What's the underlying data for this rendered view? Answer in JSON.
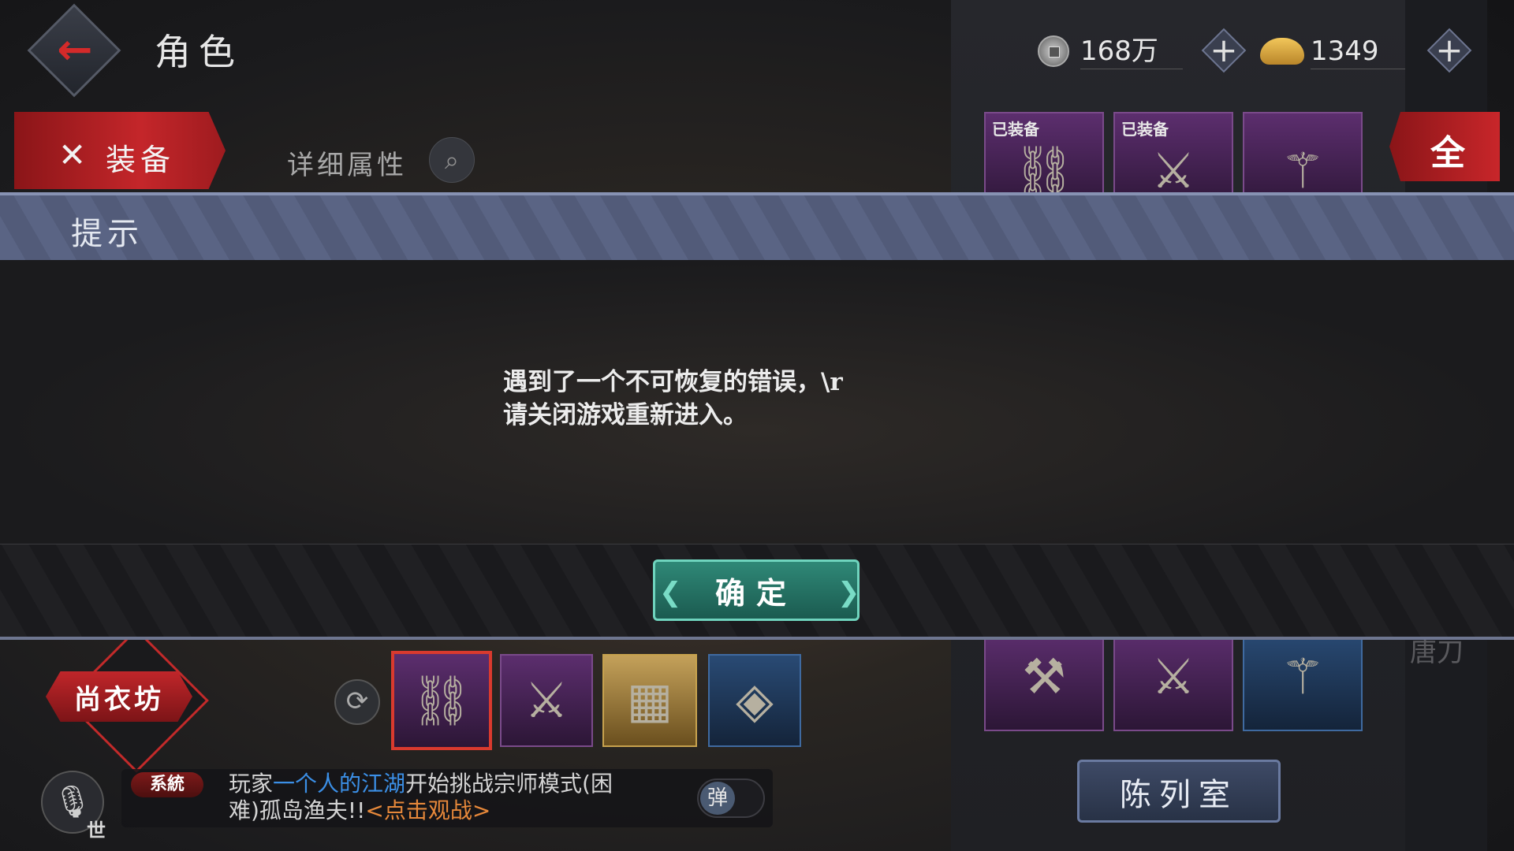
{
  "header": {
    "title": "角色",
    "back_icon": "back-arrow-icon"
  },
  "currency": {
    "coins": "168万",
    "ingots": "1349",
    "plus_label": "+"
  },
  "tabs": {
    "equip_label": "装备",
    "equip_icon": "✕",
    "detail_label": "详细属性",
    "search_icon": "⌕"
  },
  "inventory": {
    "equipped_tag": "已装备",
    "filter_label": "全",
    "top_slots": [
      {
        "equipped": true,
        "glyph": "⛓"
      },
      {
        "equipped": true,
        "glyph": "⚔"
      },
      {
        "equipped": false,
        "glyph": "⚚"
      }
    ],
    "bottom_slots": [
      {
        "glyph": "⚒"
      },
      {
        "glyph": "⚔"
      },
      {
        "glyph": "⚚"
      }
    ],
    "faint_label": "唐刀"
  },
  "equipped_bar": {
    "slots": [
      {
        "glyph": "⛓"
      },
      {
        "glyph": "⚔"
      },
      {
        "glyph": "▦"
      },
      {
        "glyph": "◈"
      }
    ],
    "swap_icon": "⟳"
  },
  "modal": {
    "title": "提示",
    "message": "遇到了一个不可恢复的错误，\\r\n请关闭游戏重新进入。",
    "confirm_label": "确定"
  },
  "bottom": {
    "tailor_label": "尚衣坊",
    "gallery_label": "陈列室",
    "voice_icon": "🎙",
    "channel": "世"
  },
  "chat": {
    "badge": "系統",
    "line1_a": "玩家",
    "line1_player": "一个人的江湖",
    "line1_b": "开始挑战宗师模式(困",
    "line2_a": "难)孤岛渔夫!!",
    "line2_link": "<点击观战>",
    "danmu_label": "弹"
  },
  "colors": {
    "accent_red": "#c4262a",
    "confirm_teal": "#2f8877",
    "player_blue": "#3b8fe6",
    "link_orange": "#e6883a"
  }
}
